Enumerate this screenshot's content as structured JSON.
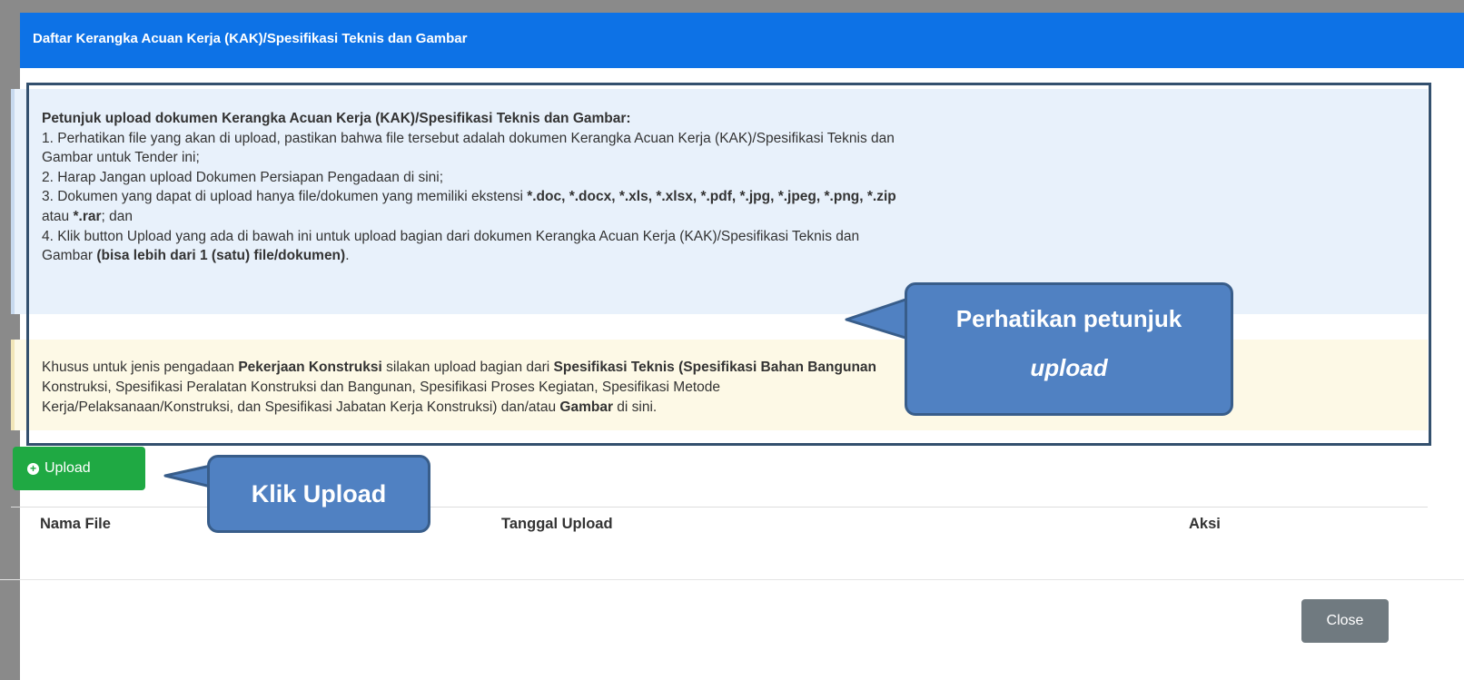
{
  "modal": {
    "title": "Daftar Kerangka Acuan Kerja (KAK)/Spesifikasi Teknis dan Gambar"
  },
  "instructions": {
    "heading": "Petunjuk upload dokumen Kerangka Acuan Kerja (KAK)/Spesifikasi Teknis dan Gambar:",
    "item1_line1": "1. Perhatikan file yang akan di upload, pastikan bahwa file tersebut adalah dokumen Kerangka Acuan Kerja (KAK)/Spesifikasi Teknis dan",
    "item1_line2": "Gambar untuk Tender ini;",
    "item2": "2. Harap Jangan upload Dokumen Persiapan Pengadaan di sini;",
    "item3_prefix": "3. Dokumen yang dapat di upload hanya file/dokumen yang memiliki ekstensi ",
    "item3_extensions": "*.doc, *.docx, *.xls, *.xlsx, *.pdf, *.jpg, *.jpeg, *.png, *.zip",
    "item3_or": "atau ",
    "item3_rar": "*.rar",
    "item3_suffix": "; dan",
    "item4_line1": "4. Klik button Upload yang ada di bawah ini untuk upload bagian dari dokumen Kerangka Acuan Kerja (KAK)/Spesifikasi Teknis dan",
    "item4_line2_prefix": "Gambar ",
    "item4_line2_bold": "(bisa lebih dari 1 (satu) file/dokumen)",
    "item4_line2_suffix": "."
  },
  "warning": {
    "l1_a": "Khusus untuk jenis pengadaan ",
    "l1_b": "Pekerjaan Konstruksi",
    "l1_c": " silakan upload bagian dari ",
    "l1_d": "Spesifikasi Teknis (Spesifikasi Bahan Bangunan",
    "l2": "Konstruksi, Spesifikasi Peralatan Konstruksi dan Bangunan, Spesifikasi Proses Kegiatan, Spesifikasi Metode",
    "l3_a": "Kerja/Pelaksanaan/Konstruksi, dan Spesifikasi Jabatan Kerja Konstruksi) dan/atau ",
    "l3_b": "Gambar",
    "l3_c": " di sini."
  },
  "upload_button": {
    "icon": "plus-circle-icon",
    "label": "Upload"
  },
  "table": {
    "columns": [
      "Nama File",
      "Tanggal Upload",
      "Aksi"
    ]
  },
  "close_button": {
    "label": "Close"
  },
  "callouts": {
    "petunjuk_line1": "Perhatikan petunjuk",
    "petunjuk_line2": "upload",
    "upload": "Klik Upload"
  },
  "colors": {
    "header": "#0d72e6",
    "upload_button": "#1fa943",
    "close_button": "#707a80",
    "callout_fill": "#5081c2",
    "callout_border": "#385d8a",
    "frame_border": "#33506e"
  }
}
